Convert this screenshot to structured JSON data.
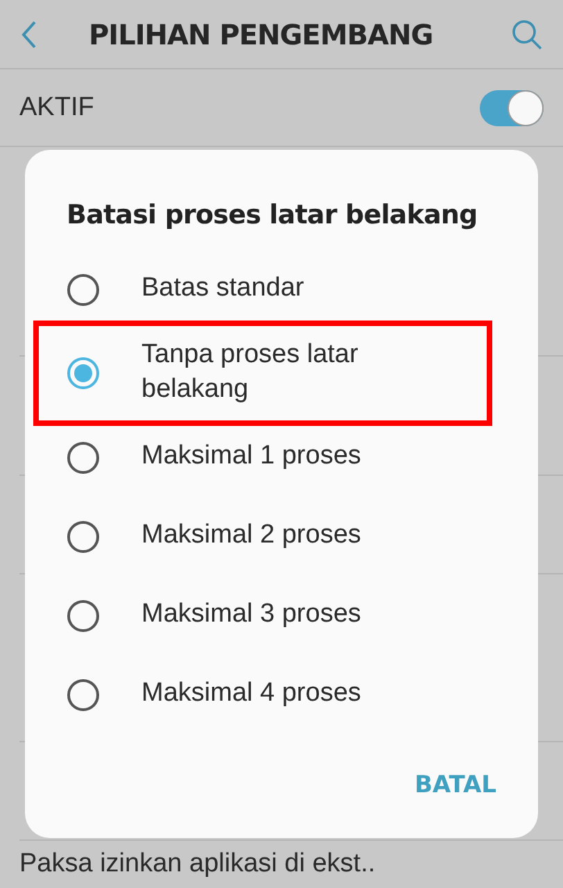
{
  "header": {
    "title": "PILIHAN PENGEMBANG"
  },
  "master_switch": {
    "label": "AKTIF",
    "on": true
  },
  "background_item": {
    "label": "Paksa izinkan aplikasi di ekst.."
  },
  "dialog": {
    "title": "Batasi proses latar belakang",
    "options": [
      {
        "label": "Batas standar",
        "selected": false,
        "highlighted": false
      },
      {
        "label": "Tanpa proses latar belakang",
        "selected": true,
        "highlighted": true
      },
      {
        "label": "Maksimal 1 proses",
        "selected": false,
        "highlighted": false
      },
      {
        "label": "Maksimal 2 proses",
        "selected": false,
        "highlighted": false
      },
      {
        "label": "Maksimal 3 proses",
        "selected": false,
        "highlighted": false
      },
      {
        "label": "Maksimal 4 proses",
        "selected": false,
        "highlighted": false
      }
    ],
    "cancel": "BATAL"
  }
}
